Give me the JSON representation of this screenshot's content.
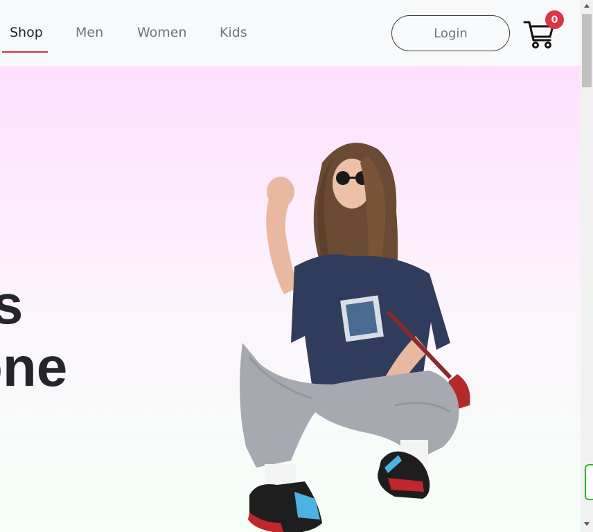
{
  "nav": {
    "links": [
      {
        "label": "Shop",
        "active": true
      },
      {
        "label": "Men",
        "active": false
      },
      {
        "label": "Women",
        "active": false
      },
      {
        "label": "Kids",
        "active": false
      }
    ],
    "login_label": "Login",
    "cart_count": "0",
    "cart_icon": "shopping-cart-icon"
  },
  "hero": {
    "line1": "ns",
    "line2": "one"
  },
  "colors": {
    "accent_red": "#d93030",
    "badge_red": "#dc3545",
    "text_dark": "#24262b",
    "nav_bg": "#f8f9fa",
    "hero_top": "#fde0fd",
    "hero_bottom": "#f6fff8"
  }
}
